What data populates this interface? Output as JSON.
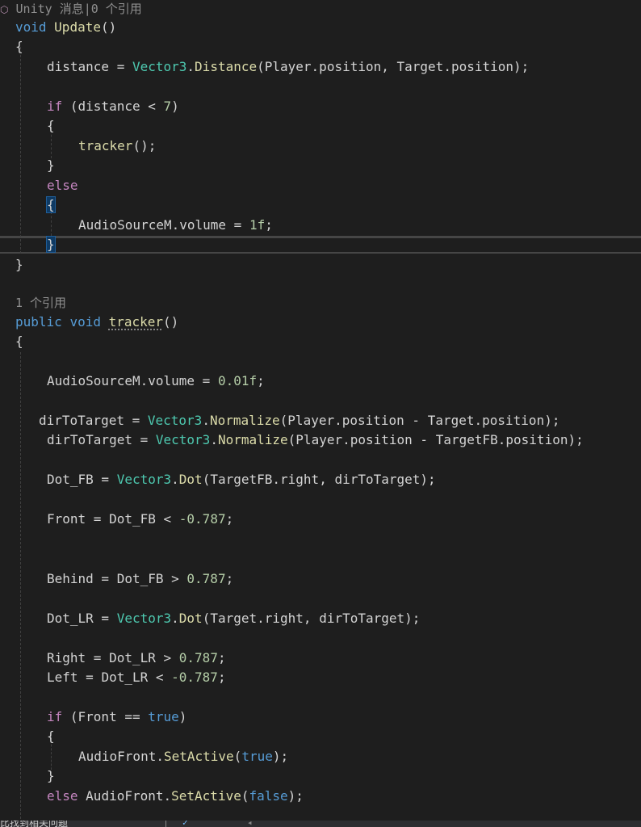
{
  "codelens": {
    "update": {
      "prefix": "Unity 消息",
      "refs": "0 个引用"
    },
    "tracker": {
      "refs": "1 个引用"
    }
  },
  "code": {
    "void": "void",
    "public": "public",
    "if": "if",
    "else": "else",
    "true": "true",
    "false": "false",
    "update_name": "Update",
    "tracker_name": "tracker",
    "vector3": "Vector3",
    "distance_method": "Distance",
    "normalize_method": "Normalize",
    "dot_method": "Dot",
    "setactive_method": "SetActive",
    "distance_var": "distance",
    "player_pos": "Player.position",
    "target_pos": "Target.position",
    "targetfb_pos": "TargetFB.position",
    "audiosource_volume": "AudioSourceM.volume",
    "vol_1": "1f",
    "vol_001": "0.01f",
    "seven": "7",
    "dir": "dirToTarget",
    "dot_fb": "Dot_FB",
    "dot_lr": "Dot_LR",
    "targetfb_right": "TargetFB.right",
    "target_right": "Target.right",
    "front": "Front",
    "behind": "Behind",
    "right": "Right",
    "left": "Left",
    "neg_thr": "-0.787",
    "pos_thr": "0.787",
    "audiofront": "AudioFront"
  },
  "statusbar": {
    "text": "比找到相关问题",
    "icon": "check-brush-icon"
  }
}
